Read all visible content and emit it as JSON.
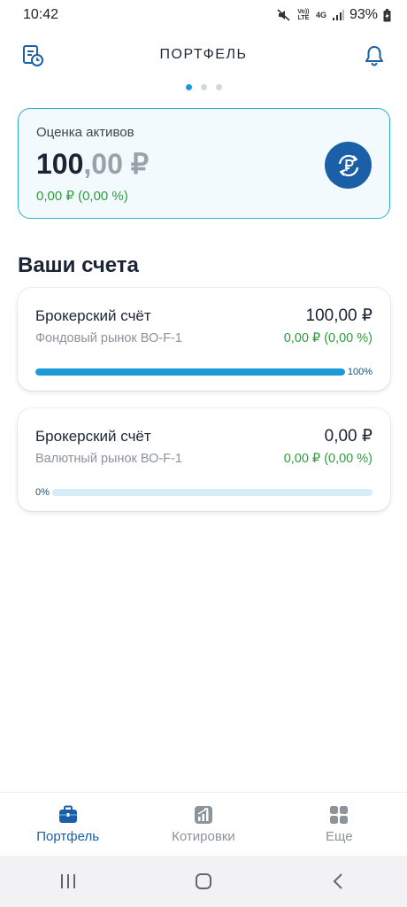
{
  "status_bar": {
    "time": "10:42",
    "battery": "93%",
    "volte": "Vo)) LTE",
    "network": "4G"
  },
  "header": {
    "title": "ПОРТФЕЛЬ"
  },
  "assets": {
    "label": "Оценка активов",
    "value_int": "100",
    "value_frac": ",00 ₽",
    "change": "0,00 ₽ (0,00 %)"
  },
  "section_title": "Ваши счета",
  "accounts": [
    {
      "name": "Брокерский счёт",
      "amount": "100,00 ₽",
      "market": "Фондовый рынок ВО-F-1",
      "change": "0,00 ₽ (0,00 %)",
      "progress": 1.0,
      "progress_label": "100%",
      "label_pos": "right"
    },
    {
      "name": "Брокерский счёт",
      "amount": "0,00 ₽",
      "market": "Валютный рынок ВО-F-1",
      "change": "0,00 ₽ (0,00 %)",
      "progress": 0.0,
      "progress_label": "0%",
      "label_pos": "left"
    }
  ],
  "nav": [
    {
      "label": "Портфель",
      "icon": "briefcase-icon",
      "active": true
    },
    {
      "label": "Котировки",
      "icon": "chart-icon",
      "active": false
    },
    {
      "label": "Еще",
      "icon": "grid-icon",
      "active": false
    }
  ],
  "colors": {
    "accent": "#1a9ad6",
    "brand": "#1a5fa8",
    "positive": "#2e9c3c",
    "card_border": "#2bb3c9"
  }
}
